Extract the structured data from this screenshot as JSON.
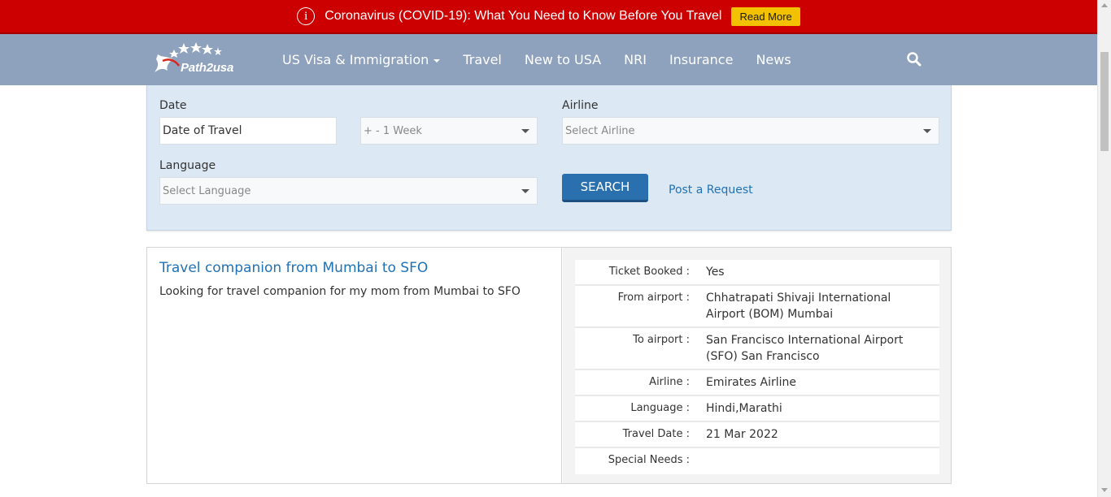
{
  "alert": {
    "icon": "info-circle-icon",
    "text": "Coronavirus (COVID-19): What You Need to Know Before You Travel",
    "button_label": "Read More",
    "bg_color": "#cc0000",
    "button_color": "#f2c200"
  },
  "header": {
    "logo_text": "Path2usa",
    "bg_color": "#8ea1bd",
    "nav": [
      {
        "label": "US Visa & Immigration",
        "has_dropdown": true
      },
      {
        "label": "Travel"
      },
      {
        "label": "New to USA"
      },
      {
        "label": "NRI"
      },
      {
        "label": "Insurance"
      },
      {
        "label": "News"
      }
    ],
    "search_icon": "search-icon"
  },
  "search": {
    "date_label": "Date",
    "date_value": "Date of Travel",
    "range_placeholder": "+ - 1 Week",
    "airline_label": "Airline",
    "airline_placeholder": "Select Airline",
    "language_label": "Language",
    "language_placeholder": "Select Language",
    "search_button": "SEARCH",
    "post_request_link": "Post a Request",
    "panel_color": "#dde8f5",
    "button_color": "#2a6fae"
  },
  "result": {
    "title": "Travel companion from Mumbai to SFO",
    "description": "Looking for travel companion for my mom from Mumbai to SFO",
    "details": [
      {
        "key": "Ticket Booked :",
        "value": "Yes"
      },
      {
        "key": "From airport :",
        "value": "Chhatrapati Shivaji International Airport (BOM) Mumbai"
      },
      {
        "key": "To airport :",
        "value": "San Francisco International Airport (SFO) San Francisco"
      },
      {
        "key": "Airline :",
        "value": "Emirates Airline"
      },
      {
        "key": "Language :",
        "value": "Hindi,Marathi"
      },
      {
        "key": "Travel Date :",
        "value": "21 Mar 2022"
      },
      {
        "key": "Special Needs :",
        "value": ""
      }
    ],
    "link_color": "#1f72b5"
  }
}
